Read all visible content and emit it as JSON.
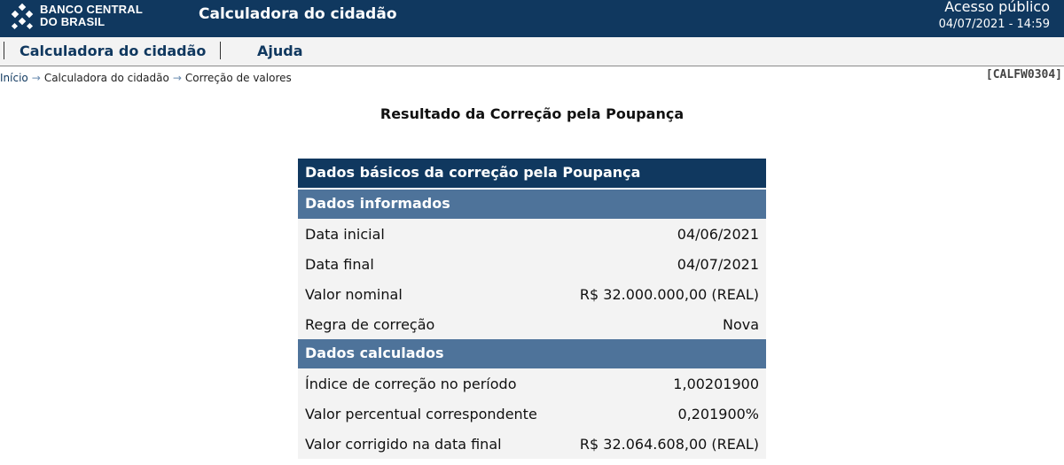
{
  "header": {
    "logo_line1": "BANCO CENTRAL",
    "logo_line2": "DO BRASIL",
    "app_title": "Calculadora do cidadão",
    "access_label": "Acesso público",
    "datetime": "04/07/2021 - 14:59"
  },
  "menu": {
    "items": [
      {
        "label": "Calculadora do cidadão"
      },
      {
        "label": "Ajuda"
      }
    ]
  },
  "breadcrumb": {
    "items": [
      "Início",
      "Calculadora do cidadão",
      "Correção de valores"
    ],
    "code": "[CALFW0304]"
  },
  "page_title": "Resultado da Correção pela Poupança",
  "result": {
    "main_header": "Dados básicos da correção pela Poupança",
    "sections": [
      {
        "title": "Dados informados",
        "rows": [
          {
            "label": "Data inicial",
            "value": "04/06/2021"
          },
          {
            "label": "Data final",
            "value": "04/07/2021"
          },
          {
            "label": "Valor nominal",
            "value": "R$ 32.000.000,00 (REAL)"
          },
          {
            "label": "Regra de correção",
            "value": "Nova"
          }
        ]
      },
      {
        "title": "Dados calculados",
        "rows": [
          {
            "label": "Índice de correção no período",
            "value": "1,00201900"
          },
          {
            "label": "Valor percentual correspondente",
            "value": "0,201900%"
          },
          {
            "label": "Valor corrigido na data final",
            "value": "R$ 32.064.608,00 (REAL)"
          }
        ]
      }
    ]
  },
  "colors": {
    "header_bg": "#10385f",
    "section_bg": "#4e739a",
    "row_bg": "#f3f3f3"
  }
}
